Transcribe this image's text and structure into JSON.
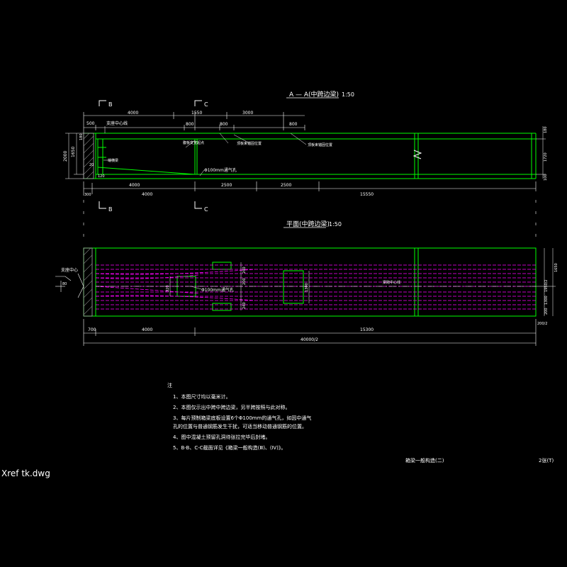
{
  "file": {
    "name": "Xref tk.dwg"
  },
  "colors": {
    "background": "#000000",
    "structure": "#00ff00",
    "tendon": "#ff00ff",
    "dimension": "#ffffff",
    "accent": "#ffff00"
  },
  "section_view": {
    "title": "A — A(中跨边梁)",
    "scale": "1:50",
    "cut_b": "B",
    "cut_c": "C",
    "top_dims": {
      "d500": "500",
      "d4000": "4000",
      "d1550": "1550",
      "d3000": "3000",
      "d800a": "800",
      "d800b": "800",
      "d800c": "800"
    },
    "bottom_dims": {
      "d300": "300",
      "d4000a": "4000",
      "d4000b": "4000",
      "d2500a": "2500",
      "d2500b": "2500",
      "d15550": "15550"
    },
    "left_dims": {
      "total": "2000",
      "part": "1650",
      "top": "180",
      "s20": "20",
      "s120": "120"
    },
    "right_dims": {
      "r180": "180",
      "r1720": "1720",
      "r100": "100"
    },
    "labels": {
      "support": "支座中心线",
      "pipe": "Φ100mm通气孔",
      "web": "腹板变宽起点",
      "anchor1": "顶板束锚固位置",
      "anchor2": "顶板束锚固位置",
      "end": "端横梁"
    }
  },
  "plan_view": {
    "title": "平面(中跨边梁)",
    "scale": "1:50",
    "labels": {
      "pier": "支座中心",
      "pipe": "Φ100mm通气孔",
      "center": "梁跨中心线"
    },
    "left_dims": {
      "h80": "80"
    },
    "box_dims": {
      "w240a": "240",
      "w240b": "240",
      "w320": "320",
      "w200": "200",
      "w1300": "1300"
    },
    "right_dims": {
      "r1650": "1650",
      "r650": "1950/2",
      "r1300": "1300",
      "r200": "200"
    },
    "bottom_dims": {
      "d700": "700",
      "d4000": "4000",
      "d15300": "15300",
      "total": "40000/2",
      "half": "200/2"
    }
  },
  "notes": {
    "heading": "注",
    "items": [
      "1、本图尺寸均以毫米计。",
      "2、本图仅示出中跨中跨边梁，另半跨按照与此对称。",
      "3、每片预制箱梁底板设置6个Φ100mm的通气孔，如因中通气",
      "   孔的位置与普通钢筋发生干扰，可适当移动普通钢筋的位置。",
      "4、图中混凝土预留孔洞待张拉完毕后封堵。",
      "5、B-B、C-C截面详见《箱梁一般构造(Ⅲ)、(Ⅳ)》。"
    ]
  },
  "title_block": {
    "title": "箱梁一般构造(二)",
    "sheet": "2张(T)"
  }
}
